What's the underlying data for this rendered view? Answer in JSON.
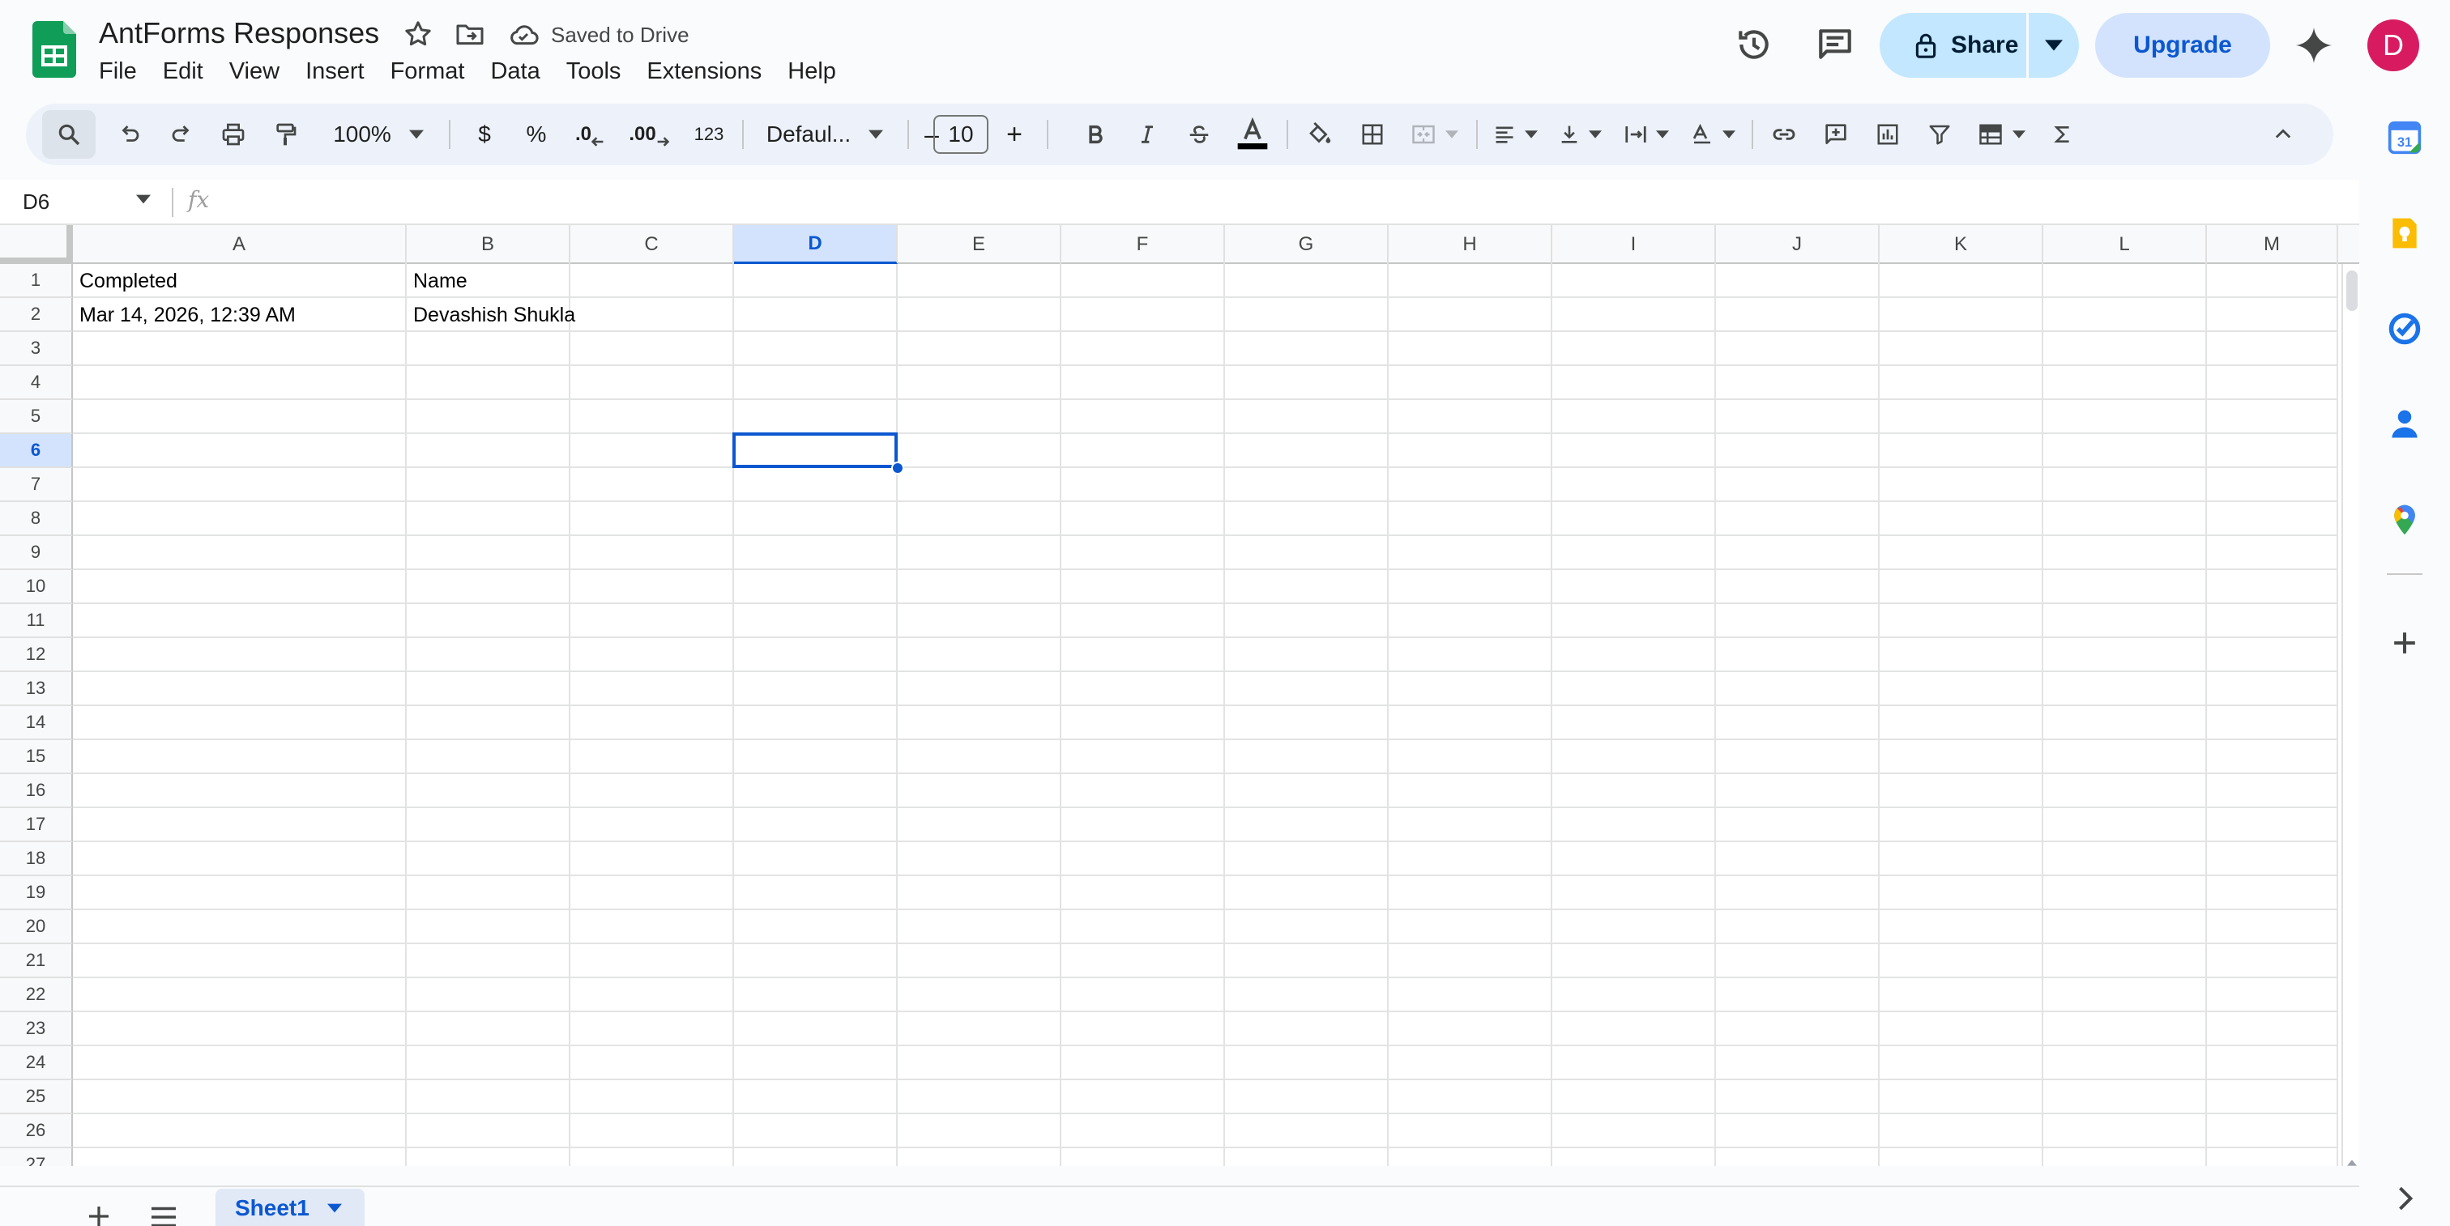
{
  "header": {
    "doc_title": "AntForms Responses",
    "save_status": "Saved to Drive",
    "share_label": "Share",
    "upgrade_label": "Upgrade",
    "avatar_initial": "D"
  },
  "menu": [
    "File",
    "Edit",
    "View",
    "Insert",
    "Format",
    "Data",
    "Tools",
    "Extensions",
    "Help"
  ],
  "toolbar": {
    "zoom": "100%",
    "currency": "$",
    "percent": "%",
    "decrease_decimal": ".0",
    "increase_decimal": ".00",
    "number_format": "123",
    "font": "Defaul...",
    "font_size": "10",
    "decrease_font": "–",
    "increase_font": "+"
  },
  "formula_bar": {
    "cell_ref": "D6",
    "fx": "fx",
    "formula": ""
  },
  "grid": {
    "columns": [
      "A",
      "B",
      "C",
      "D",
      "E",
      "F",
      "G",
      "H",
      "I",
      "J",
      "K",
      "L",
      "M"
    ],
    "selected_column": "D",
    "rows": [
      "1",
      "2",
      "3",
      "4",
      "5",
      "6",
      "7",
      "8",
      "9",
      "10",
      "11",
      "12",
      "13",
      "14",
      "15",
      "16",
      "17",
      "18",
      "19",
      "20",
      "21",
      "22",
      "23",
      "24",
      "25",
      "26",
      "27"
    ],
    "selected_row": "6",
    "cells": {
      "A1": "Completed",
      "B1": "Name",
      "A2": "Mar 14, 2026, 12:39 AM",
      "B2": "Devashish Shukla"
    }
  },
  "sheets": {
    "active_tab": "Sheet1"
  },
  "colors": {
    "accent": "#0b57d0",
    "share_bg": "#c2e7ff",
    "upgrade_bg": "#d3e3fd",
    "avatar_bg": "#d81b60",
    "sheets_green": "#0f9d58"
  }
}
